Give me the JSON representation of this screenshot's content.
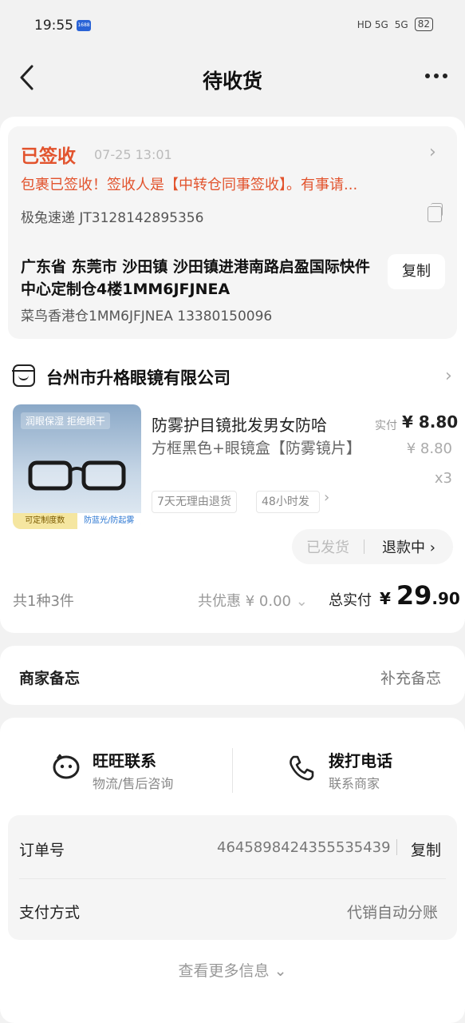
{
  "status_bar": {
    "time": "19:55",
    "app_badge": "1688",
    "signal_1": "HD 5G",
    "signal_2": "5G",
    "battery": "82"
  },
  "nav": {
    "title": "待收货"
  },
  "logistics": {
    "status": "已签收",
    "time": "07-25 13:01",
    "description": "包裹已签收！签收人是【中转仓同事签收】。有事请...",
    "courier": "极兔速递 JT3128142895356",
    "address": "广东省 东莞市 沙田镇 沙田镇进港南路启盈国际快件中心定制仓4楼1MM6JFJNEA",
    "copy_label": "复制",
    "recipient": "菜鸟香港仓1MM6JFJNEA 13380150096"
  },
  "shop": {
    "name": "台州市升格眼镜有限公司"
  },
  "product": {
    "image_tag_top": "润眼保湿  拒绝眼干",
    "image_tag_left": "可定制度数",
    "image_tag_right": "防蓝光/防起雾",
    "title": "防雾护目镜批发男女防哈",
    "spec": "方框黑色+眼镜盒【防雾镜片】",
    "paid_label": "实付",
    "paid_price": "¥ 8.80",
    "original_price": "¥ 8.80",
    "quantity": "x3",
    "tags": [
      "7天无理由退货",
      "48小时发"
    ],
    "shipped_label": "已发货",
    "refund_label": "退款中"
  },
  "summary": {
    "count": "共1种3件",
    "discount": "共优惠 ¥ 0.00",
    "total_label": "总实付",
    "currency": "¥",
    "total_int": "29",
    "total_dec": ".90"
  },
  "memo": {
    "label": "商家备忘",
    "action": "补充备忘"
  },
  "contact": {
    "wangwang_title": "旺旺联系",
    "wangwang_sub": "物流/售后咨询",
    "phone_title": "拨打电话",
    "phone_sub": "联系商家"
  },
  "order_info": {
    "order_label": "订单号",
    "order_no": "4645898424355535439",
    "copy_label": "复制",
    "pay_label": "支付方式",
    "pay_value": "代销自动分账"
  },
  "footer": {
    "more_info": "查看更多信息"
  }
}
